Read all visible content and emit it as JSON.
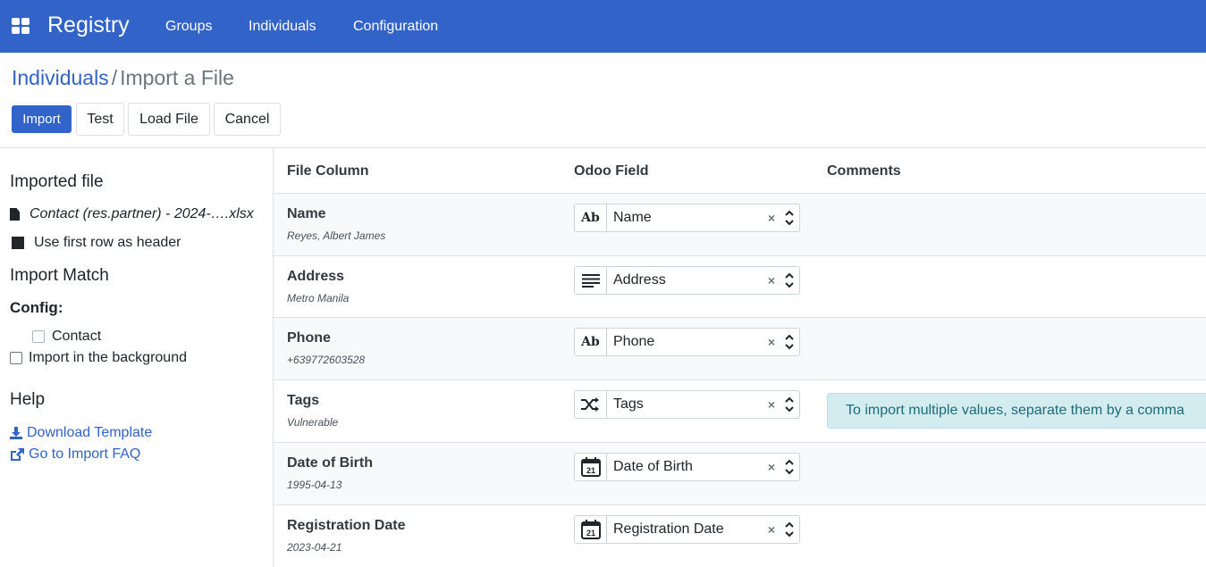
{
  "navbar": {
    "brand": "Registry",
    "items": [
      "Groups",
      "Individuals",
      "Configuration"
    ]
  },
  "breadcrumb": {
    "parent": "Individuals",
    "separator": "/",
    "current": "Import a File"
  },
  "buttons": {
    "import": "Import",
    "test": "Test",
    "load_file": "Load File",
    "cancel": "Cancel"
  },
  "sidebar": {
    "imported_file_title": "Imported file",
    "file_name": "Contact (res.partner) - 2024-….xlsx",
    "first_row_header": "Use first row as header",
    "import_match_title": "Import Match",
    "config_label": "Config:",
    "config_option": "Contact",
    "import_background": "Import in the background",
    "help_title": "Help",
    "download_template": "Download Template",
    "import_faq": "Go to Import FAQ"
  },
  "table": {
    "headers": [
      "File Column",
      "Odoo Field",
      "Comments"
    ],
    "rows": [
      {
        "column": "Name",
        "sample": "Reyes, Albert James",
        "field": "Name",
        "type_icon": "text-icon",
        "comment": ""
      },
      {
        "column": "Address",
        "sample": "Metro Manila",
        "field": "Address",
        "type_icon": "multiline-text-icon",
        "comment": ""
      },
      {
        "column": "Phone",
        "sample": "+639772603528",
        "field": "Phone",
        "type_icon": "text-icon",
        "comment": ""
      },
      {
        "column": "Tags",
        "sample": "Vulnerable",
        "field": "Tags",
        "type_icon": "relation-icon",
        "comment": "To import multiple values, separate them by a comma"
      },
      {
        "column": "Date of Birth",
        "sample": "1995-04-13",
        "field": "Date of Birth",
        "type_icon": "calendar-icon",
        "comment": ""
      },
      {
        "column": "Registration Date",
        "sample": "2023-04-21",
        "field": "Registration Date",
        "type_icon": "calendar-icon",
        "comment": ""
      }
    ],
    "text_type_label": "Ab",
    "calendar_day": "21",
    "clear_symbol": "×"
  },
  "colors": {
    "brand": "#3263c8",
    "comment_bg": "#d3ecf0",
    "comment_text": "#1c6c78"
  }
}
